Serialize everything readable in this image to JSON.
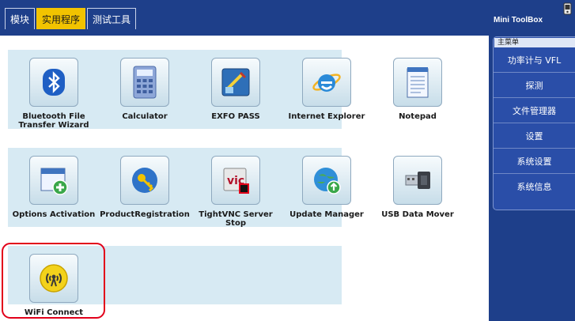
{
  "tabs": [
    {
      "label": "模块"
    },
    {
      "label": "实用程序"
    },
    {
      "label": "测试工具"
    }
  ],
  "apps": [
    {
      "label": "Bluetooth File Transfer Wizard",
      "icon": "bluetooth-icon"
    },
    {
      "label": "Calculator",
      "icon": "calculator-icon"
    },
    {
      "label": "EXFO PASS",
      "icon": "exfo-pass-icon"
    },
    {
      "label": "Internet Explorer",
      "icon": "internet-explorer-icon"
    },
    {
      "label": "Notepad",
      "icon": "notepad-icon"
    },
    {
      "label": "Options Activation",
      "icon": "options-activation-icon"
    },
    {
      "label": "ProductRegistration",
      "icon": "product-registration-icon"
    },
    {
      "label": "TightVNC Server Stop",
      "icon": "tightvnc-icon"
    },
    {
      "label": "Update Manager",
      "icon": "update-manager-icon"
    },
    {
      "label": "USB Data Mover",
      "icon": "usb-icon"
    },
    {
      "label": "WiFi Connect",
      "icon": "wifi-icon"
    }
  ],
  "sidebar": {
    "title": "Mini ToolBox",
    "icon": "device-icon",
    "menu_title": "主菜单",
    "items": [
      {
        "label": "功率计与 VFL"
      },
      {
        "label": "探测"
      },
      {
        "label": "文件管理器"
      },
      {
        "label": "设置"
      },
      {
        "label": "系统设置"
      },
      {
        "label": "系统信息"
      }
    ]
  },
  "colors": {
    "header": "#1e3f8a",
    "active_tab": "#f2c300",
    "band": "#d7eaf3",
    "highlight": "#e2001a"
  }
}
